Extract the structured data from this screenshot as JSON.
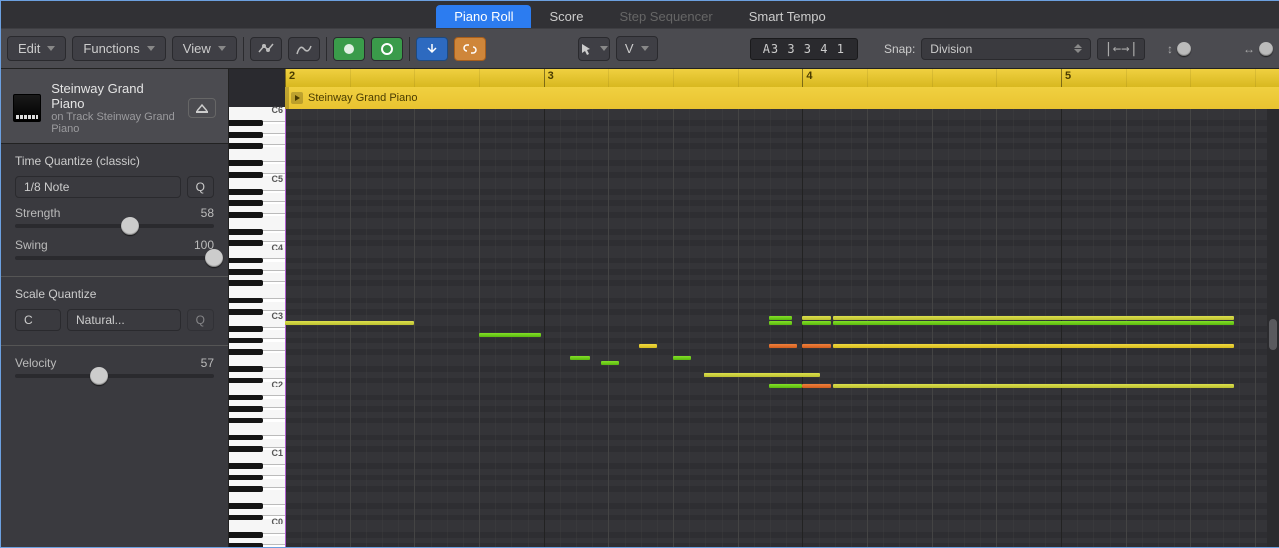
{
  "top_tabs": [
    "Piano Roll",
    "Score",
    "Step Sequencer",
    "Smart Tempo"
  ],
  "top_tab_active": 0,
  "top_tab_disabled": [
    2
  ],
  "toolbar": {
    "menus": {
      "edit": "Edit",
      "functions": "Functions",
      "view": "View"
    },
    "snap_label": "Snap:",
    "snap_value": "Division",
    "info_display": "A3  3 3 4 1",
    "collapse_one": "V"
  },
  "track": {
    "name": "Steinway Grand Piano",
    "subtitle": "on Track Steinway Grand Piano",
    "region_name": "Steinway Grand Piano"
  },
  "time_quantize": {
    "title": "Time Quantize (classic)",
    "value": "1/8 Note",
    "button": "Q",
    "strength_label": "Strength",
    "strength_value": 58,
    "swing_label": "Swing",
    "swing_value": 100
  },
  "scale_quantize": {
    "title": "Scale Quantize",
    "root": "C",
    "scale": "Natural...",
    "button": "Q"
  },
  "velocity": {
    "label": "Velocity",
    "value": 57
  },
  "chart_data": {
    "type": "piano-roll",
    "view": {
      "pitch_range": [
        "G#-1",
        "C6"
      ],
      "time_range_bars": [
        2,
        5.8
      ],
      "key_labels": [
        "C5",
        "C4",
        "C3",
        "C2",
        "C1"
      ]
    },
    "ruler_bars": [
      2,
      3,
      4,
      5
    ],
    "beats_per_bar": 4,
    "divisions_per_beat": 4,
    "notes": [
      {
        "pitch": "B2",
        "start": 2.0,
        "len": 0.24,
        "color": "green"
      },
      {
        "pitch": "B2",
        "start": 2.0,
        "len": 0.5,
        "color": "olive"
      },
      {
        "pitch": "A2",
        "start": 2.75,
        "len": 0.24,
        "color": "green"
      },
      {
        "pitch": "F2",
        "start": 3.1,
        "len": 0.08,
        "color": "green"
      },
      {
        "pitch": "G2",
        "start": 3.37,
        "len": 0.07,
        "color": "yellow"
      },
      {
        "pitch": "E2",
        "start": 3.22,
        "len": 0.07,
        "color": "green"
      },
      {
        "pitch": "F2",
        "start": 3.5,
        "len": 0.07,
        "color": "green"
      },
      {
        "pitch": "D2",
        "start": 3.62,
        "len": 0.45,
        "color": "olive"
      },
      {
        "pitch": "D2",
        "start": 3.62,
        "len": 0.22,
        "color": "olive"
      },
      {
        "pitch": "C2",
        "start": 3.93,
        "len": 0.07,
        "color": "green"
      },
      {
        "pitch": "G2",
        "start": 3.87,
        "len": 0.11,
        "color": "orange"
      },
      {
        "pitch": "C3",
        "start": 3.87,
        "len": 0.09,
        "color": "green"
      },
      {
        "pitch": "B2",
        "start": 3.87,
        "len": 0.09,
        "color": "green"
      },
      {
        "pitch": "C2",
        "start": 3.87,
        "len": 0.11,
        "color": "green"
      },
      {
        "pitch": "C3",
        "start": 4.0,
        "len": 0.11,
        "color": "olive"
      },
      {
        "pitch": "B2",
        "start": 4.0,
        "len": 0.11,
        "color": "green"
      },
      {
        "pitch": "G2",
        "start": 4.0,
        "len": 0.11,
        "color": "orange"
      },
      {
        "pitch": "C2",
        "start": 4.0,
        "len": 0.11,
        "color": "orange"
      },
      {
        "pitch": "C3",
        "start": 4.12,
        "len": 1.55,
        "color": "olive"
      },
      {
        "pitch": "B2",
        "start": 4.12,
        "len": 1.55,
        "color": "green"
      },
      {
        "pitch": "G2",
        "start": 4.12,
        "len": 1.55,
        "color": "yellow"
      },
      {
        "pitch": "C2",
        "start": 4.12,
        "len": 1.55,
        "color": "olive"
      }
    ]
  },
  "scroll": {
    "v_pos": 0.48,
    "v_size": 0.07
  }
}
